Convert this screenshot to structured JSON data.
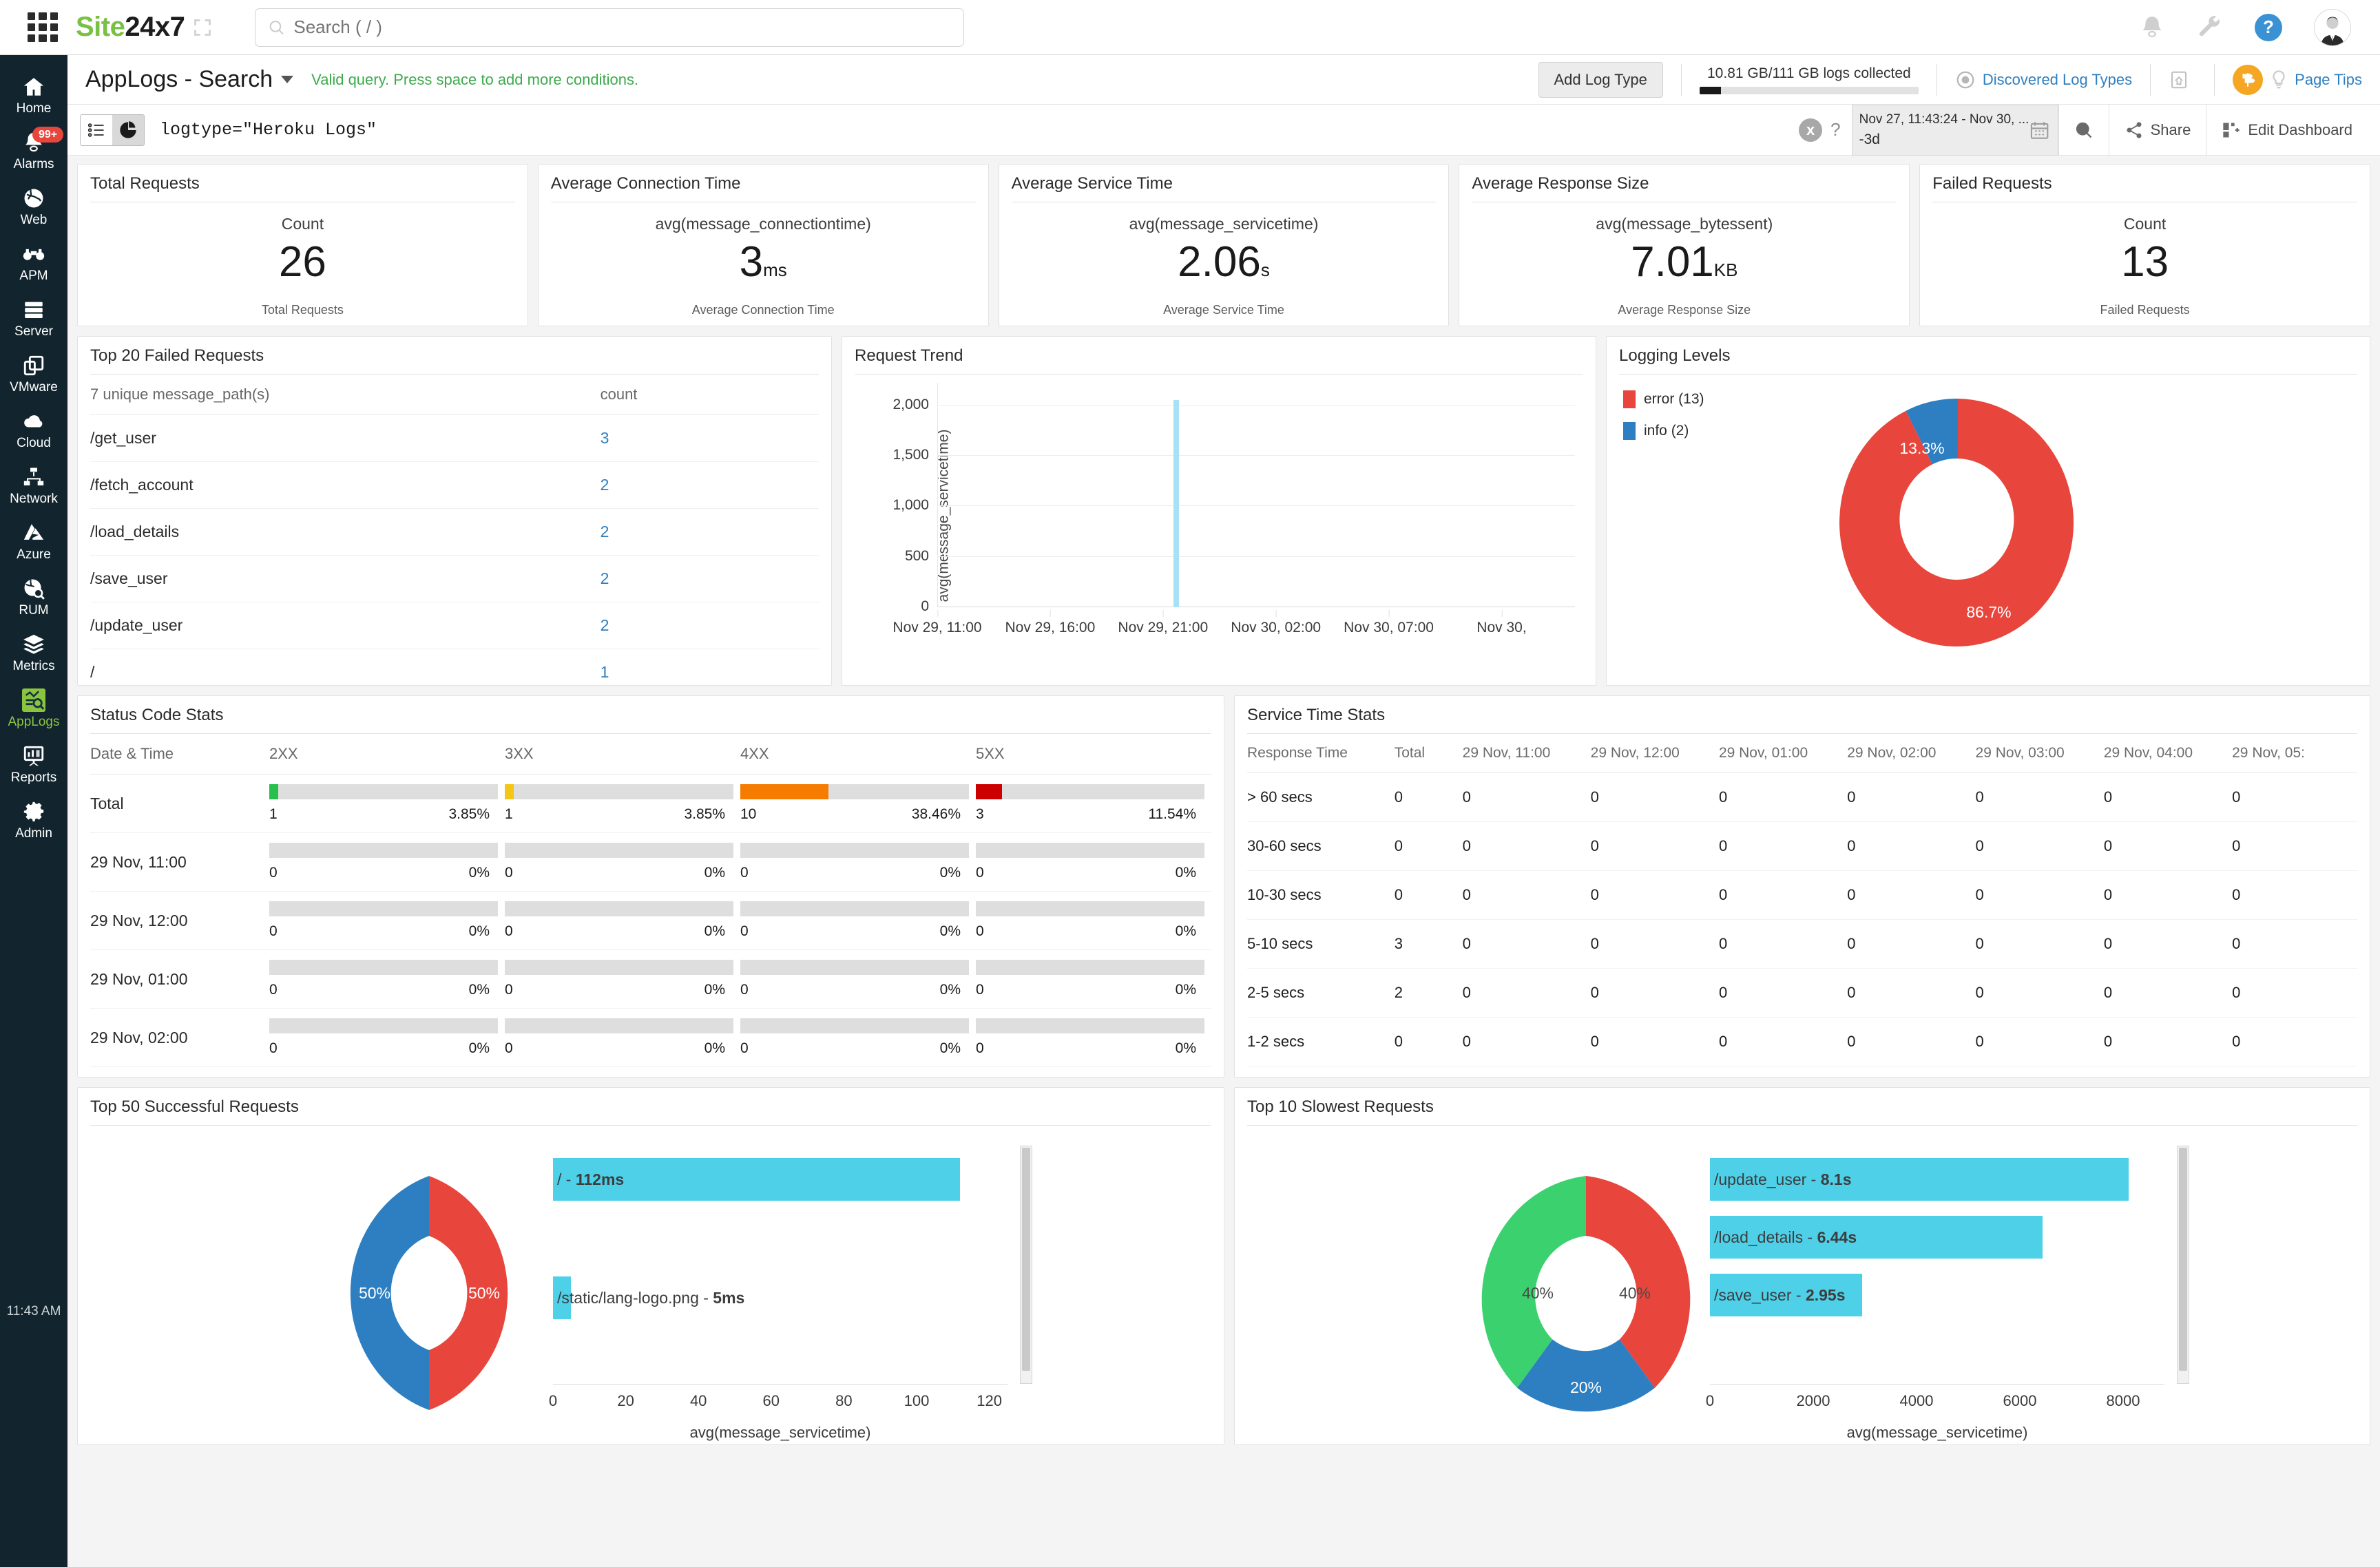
{
  "topbar": {
    "logo_green": "Site",
    "logo_black": "24x7",
    "search_placeholder": "Search ( / )",
    "icons": [
      "bell-icon",
      "wrench-icon",
      "help-icon",
      "avatar"
    ]
  },
  "sidebar": {
    "clock": "11:43 AM",
    "items": [
      {
        "label": "Home",
        "icon": "home-icon",
        "active": false
      },
      {
        "label": "Alarms",
        "icon": "bell-icon",
        "active": false,
        "badge": "99+"
      },
      {
        "label": "Web",
        "icon": "globe-icon",
        "active": false
      },
      {
        "label": "APM",
        "icon": "binoculars-icon",
        "active": false
      },
      {
        "label": "Server",
        "icon": "server-icon",
        "active": false
      },
      {
        "label": "VMware",
        "icon": "windows-stack-icon",
        "active": false
      },
      {
        "label": "Cloud",
        "icon": "cloud-icon",
        "active": false
      },
      {
        "label": "Network",
        "icon": "network-icon",
        "active": false
      },
      {
        "label": "Azure",
        "icon": "azure-icon",
        "active": false
      },
      {
        "label": "RUM",
        "icon": "globe-search-icon",
        "active": false
      },
      {
        "label": "Metrics",
        "icon": "layers-icon",
        "active": false
      },
      {
        "label": "AppLogs",
        "icon": "applogs-icon",
        "active": true
      },
      {
        "label": "Reports",
        "icon": "report-icon",
        "active": false
      },
      {
        "label": "Admin",
        "icon": "gear-icon",
        "active": false
      }
    ]
  },
  "page_header": {
    "title": "AppLogs - Search",
    "validation_message": "Valid query. Press space to add more conditions.",
    "add_log_type": "Add Log Type",
    "logs_collected": "10.81 GB/111 GB logs collected",
    "logs_collected_pct": 9.7,
    "discovered_log_types": "Discovered Log Types",
    "page_tips": "Page Tips"
  },
  "query_bar": {
    "query": "logtype=\"Heroku Logs\"",
    "clear_label": "x",
    "help_label": "?",
    "date_range_line1": "Nov 27, 11:43:24 - Nov 30, ...",
    "date_range_line2": "-3d",
    "share_label": "Share",
    "edit_dashboard_label": "Edit Dashboard"
  },
  "kpis": [
    {
      "title": "Total Requests",
      "agg": "Count",
      "value": "26",
      "unit": "",
      "footer": "Total Requests"
    },
    {
      "title": "Average Connection Time",
      "agg": "avg(message_connectiontime)",
      "value": "3",
      "unit": "ms",
      "footer": "Average Connection Time"
    },
    {
      "title": "Average Service Time",
      "agg": "avg(message_servicetime)",
      "value": "2.06",
      "unit": "s",
      "footer": "Average Service Time"
    },
    {
      "title": "Average Response Size",
      "agg": "avg(message_bytessent)",
      "value": "7.01",
      "unit": "KB",
      "footer": "Average Response Size"
    },
    {
      "title": "Failed Requests",
      "agg": "Count",
      "value": "13",
      "unit": "",
      "footer": "Failed Requests"
    }
  ],
  "failed_requests": {
    "title": "Top 20 Failed Requests",
    "col_path": "7 unique message_path(s)",
    "col_count": "count",
    "rows": [
      {
        "path": "/get_user",
        "count": "3"
      },
      {
        "path": "/fetch_account",
        "count": "2"
      },
      {
        "path": "/load_details",
        "count": "2"
      },
      {
        "path": "/save_user",
        "count": "2"
      },
      {
        "path": "/update_user",
        "count": "2"
      },
      {
        "path": "/",
        "count": "1"
      }
    ]
  },
  "chart_data": [
    {
      "name": "request_trend",
      "type": "bar",
      "title": "Request Trend",
      "xlabel": "",
      "ylabel": "avg(message_servicetime)",
      "ylim": [
        0,
        2100
      ],
      "yticks": [
        0,
        500,
        1000,
        1500,
        2000
      ],
      "ytick_labels": [
        "0",
        "500",
        "1,000",
        "1,500",
        "2,000"
      ],
      "xtick_labels": [
        "Nov 29, 11:00",
        "Nov 29, 16:00",
        "Nov 29, 21:00",
        "Nov 30, 02:00",
        "Nov 30, 07:00",
        "Nov 30,"
      ],
      "categories": [
        "Nov 29, 21:30"
      ],
      "values": [
        2050
      ],
      "grid": true,
      "series_color": "#a8e1f3"
    },
    {
      "name": "logging_levels",
      "type": "pie",
      "title": "Logging Levels",
      "legend_position": "left",
      "labels": [
        "error (13)",
        "info (2)"
      ],
      "values": [
        13,
        2
      ],
      "percent_labels": [
        "86.7%",
        "13.3%"
      ],
      "colors": [
        "#e8453c",
        "#2d7fc1"
      ]
    },
    {
      "name": "top_50_successful_requests_donut",
      "type": "pie",
      "title": "Top 50 Successful Requests",
      "labels": [
        "/",
        "/static/lang-logo.png"
      ],
      "values": [
        50,
        50
      ],
      "percent_labels": [
        "50%",
        "50%"
      ],
      "colors": [
        "#e8453c",
        "#2d7fc1"
      ]
    },
    {
      "name": "top_50_successful_requests_bars",
      "type": "bar",
      "title": "Top 50 Successful Requests",
      "orientation": "horizontal",
      "xlabel": "avg(message_servicetime)",
      "xlim": [
        0,
        125
      ],
      "xticks": [
        0,
        20,
        40,
        60,
        80,
        100,
        120
      ],
      "xtick_labels": [
        "0",
        "20",
        "40",
        "60",
        "80",
        "100",
        "120"
      ],
      "categories": [
        "/",
        "/static/lang-logo.png"
      ],
      "values": [
        112,
        5
      ],
      "bar_labels": [
        "/ - 112ms",
        "/static/lang-logo.png - 5ms"
      ],
      "bar_label_paths": [
        "/",
        "/static/lang-logo.png"
      ],
      "bar_label_values": [
        "112ms",
        "5ms"
      ],
      "series_color": "#4dd0e8"
    },
    {
      "name": "top_10_slowest_requests_donut",
      "type": "pie",
      "title": "Top 10 Slowest Requests",
      "labels": [
        "/update_user",
        "/load_details",
        "/save_user"
      ],
      "values": [
        40,
        20,
        40
      ],
      "percent_labels": [
        "40%",
        "20%",
        "40%"
      ],
      "colors": [
        "#e8453c",
        "#2d7fc1",
        "#3ad16e"
      ]
    },
    {
      "name": "top_10_slowest_requests_bars",
      "type": "bar",
      "title": "Top 10 Slowest Requests",
      "orientation": "horizontal",
      "xlabel": "avg(message_servicetime)",
      "xlim": [
        0,
        8800
      ],
      "xticks": [
        0,
        2000,
        4000,
        6000,
        8000
      ],
      "xtick_labels": [
        "0",
        "2000",
        "4000",
        "6000",
        "8000"
      ],
      "categories": [
        "/update_user",
        "/load_details",
        "/save_user"
      ],
      "values": [
        8100,
        6440,
        2950
      ],
      "bar_labels": [
        "/update_user - 8.1s",
        "/load_details - 6.44s",
        "/save_user - 2.95s"
      ],
      "bar_label_paths": [
        "/update_user",
        "/load_details",
        "/save_user"
      ],
      "bar_label_values": [
        "8.1s",
        "6.44s",
        "2.95s"
      ],
      "series_color": "#4dd0e8"
    }
  ],
  "status_code_stats": {
    "title": "Status Code Stats",
    "columns": [
      "Date & Time",
      "2XX",
      "3XX",
      "4XX",
      "5XX"
    ],
    "colors": {
      "2XX": "#28c04a",
      "3XX": "#f5c518",
      "4XX": "#f57c00",
      "5XX": "#cc0000"
    },
    "rows": [
      {
        "label": "Total",
        "cells": [
          {
            "count": "1",
            "pct": "3.85%",
            "fill": 3.85
          },
          {
            "count": "1",
            "pct": "3.85%",
            "fill": 3.85
          },
          {
            "count": "10",
            "pct": "38.46%",
            "fill": 38.46
          },
          {
            "count": "3",
            "pct": "11.54%",
            "fill": 11.54
          }
        ]
      },
      {
        "label": "29 Nov, 11:00",
        "cells": [
          {
            "count": "0",
            "pct": "0%",
            "fill": 0
          },
          {
            "count": "0",
            "pct": "0%",
            "fill": 0
          },
          {
            "count": "0",
            "pct": "0%",
            "fill": 0
          },
          {
            "count": "0",
            "pct": "0%",
            "fill": 0
          }
        ]
      },
      {
        "label": "29 Nov, 12:00",
        "cells": [
          {
            "count": "0",
            "pct": "0%",
            "fill": 0
          },
          {
            "count": "0",
            "pct": "0%",
            "fill": 0
          },
          {
            "count": "0",
            "pct": "0%",
            "fill": 0
          },
          {
            "count": "0",
            "pct": "0%",
            "fill": 0
          }
        ]
      },
      {
        "label": "29 Nov, 01:00",
        "cells": [
          {
            "count": "0",
            "pct": "0%",
            "fill": 0
          },
          {
            "count": "0",
            "pct": "0%",
            "fill": 0
          },
          {
            "count": "0",
            "pct": "0%",
            "fill": 0
          },
          {
            "count": "0",
            "pct": "0%",
            "fill": 0
          }
        ]
      },
      {
        "label": "29 Nov, 02:00",
        "cells": [
          {
            "count": "0",
            "pct": "0%",
            "fill": 0
          },
          {
            "count": "0",
            "pct": "0%",
            "fill": 0
          },
          {
            "count": "0",
            "pct": "0%",
            "fill": 0
          },
          {
            "count": "0",
            "pct": "0%",
            "fill": 0
          }
        ]
      }
    ]
  },
  "service_time_stats": {
    "title": "Service Time Stats",
    "columns": [
      "Response Time",
      "Total",
      "29 Nov, 11:00",
      "29 Nov, 12:00",
      "29 Nov, 01:00",
      "29 Nov, 02:00",
      "29 Nov, 03:00",
      "29 Nov, 04:00",
      "29 Nov, 05:"
    ],
    "rows": [
      {
        "label": "> 60 secs",
        "values": [
          "0",
          "0",
          "0",
          "0",
          "0",
          "0",
          "0",
          "0"
        ]
      },
      {
        "label": "30-60 secs",
        "values": [
          "0",
          "0",
          "0",
          "0",
          "0",
          "0",
          "0",
          "0"
        ]
      },
      {
        "label": "10-30 secs",
        "values": [
          "0",
          "0",
          "0",
          "0",
          "0",
          "0",
          "0",
          "0"
        ]
      },
      {
        "label": "5-10 secs",
        "values": [
          "3",
          "0",
          "0",
          "0",
          "0",
          "0",
          "0",
          "0"
        ]
      },
      {
        "label": "2-5 secs",
        "values": [
          "2",
          "0",
          "0",
          "0",
          "0",
          "0",
          "0",
          "0"
        ]
      },
      {
        "label": "1-2 secs",
        "values": [
          "0",
          "0",
          "0",
          "0",
          "0",
          "0",
          "0",
          "0"
        ]
      }
    ]
  }
}
